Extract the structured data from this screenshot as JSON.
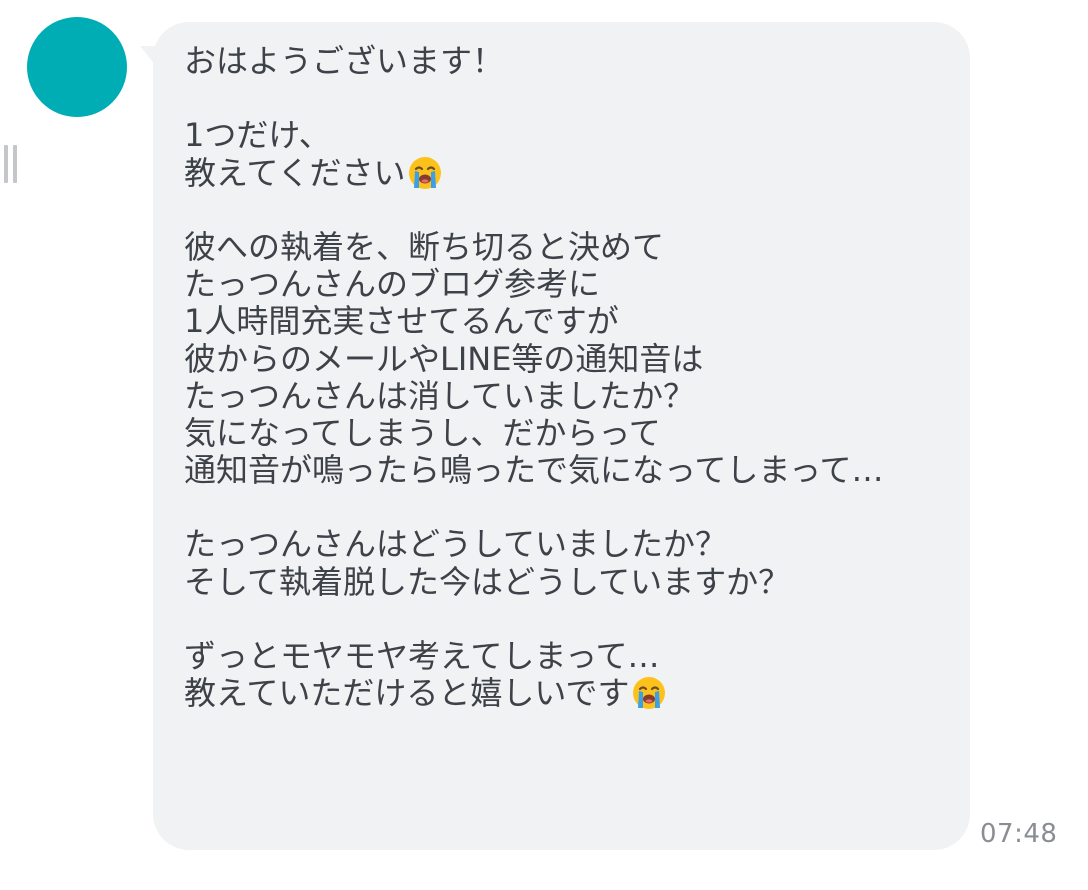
{
  "conversation": {
    "avatar_color": "#00adb5",
    "bubble_color": "#f1f2f4",
    "text_color": "#3d4148",
    "message": {
      "lines": [
        {
          "text": "おはようございます！",
          "emoji": null
        },
        {
          "text": "",
          "emoji": null
        },
        {
          "text": "1つだけ、",
          "emoji": null
        },
        {
          "text": "教えてください",
          "emoji": "loudly-crying-face-icon"
        },
        {
          "text": "",
          "emoji": null
        },
        {
          "text": "彼への執着を、断ち切ると決めて",
          "emoji": null
        },
        {
          "text": "たっつんさんのブログ参考に",
          "emoji": null
        },
        {
          "text": "1人時間充実させてるんですが",
          "emoji": null
        },
        {
          "text": "彼からのメールやLINE等の通知音は",
          "emoji": null
        },
        {
          "text": "たっつんさんは消していましたか？",
          "emoji": null
        },
        {
          "text": "気になってしまうし、だからって",
          "emoji": null
        },
        {
          "text": "通知音が鳴ったら鳴ったで気になってしまって…",
          "emoji": null
        },
        {
          "text": "",
          "emoji": null
        },
        {
          "text": "たっつんさんはどうしていましたか？",
          "emoji": null
        },
        {
          "text": "そして執着脱した今はどうしていますか？",
          "emoji": null
        },
        {
          "text": "",
          "emoji": null
        },
        {
          "text": "ずっとモヤモヤ考えてしまって…",
          "emoji": null
        },
        {
          "text": "教えていただけると嬉しいです",
          "emoji": "loudly-crying-face-icon"
        }
      ],
      "timestamp": "07:48"
    }
  }
}
